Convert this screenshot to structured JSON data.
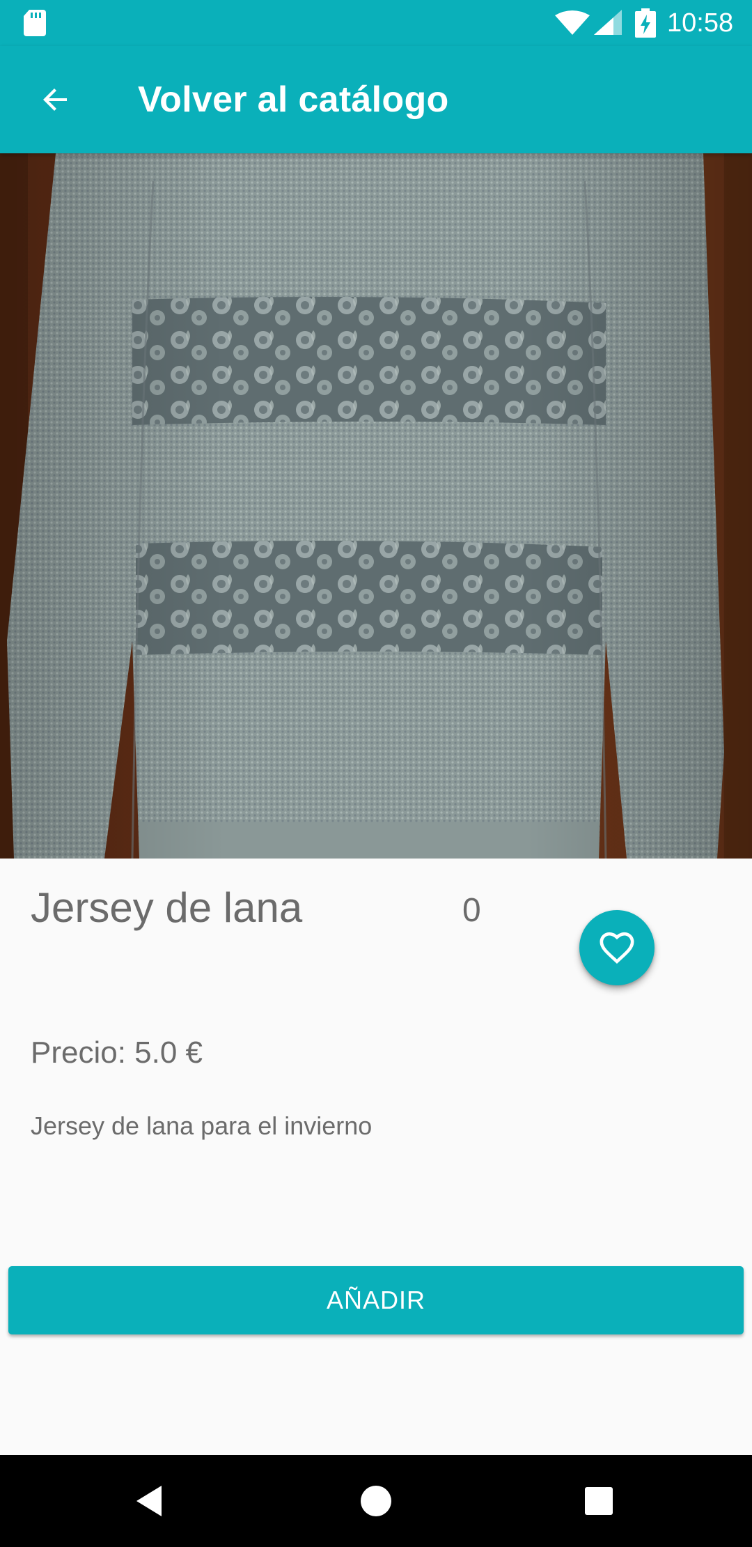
{
  "status_bar": {
    "time": "10:58",
    "icons": [
      "sd-card-icon",
      "wifi-icon",
      "signal-icon",
      "battery-charging-icon"
    ]
  },
  "toolbar": {
    "back_icon": "arrow-back-icon",
    "title": "Volver al catálogo"
  },
  "product": {
    "image_subject": "sweater-photo",
    "name": "Jersey de lana",
    "likes": "0",
    "favorite_icon": "heart-outline-icon",
    "price": "Precio: 5.0 €",
    "description": "Jersey de lana para el invierno"
  },
  "actions": {
    "add_label": "AÑADIR"
  },
  "nav": {
    "icons": [
      "nav-back-icon",
      "nav-home-icon",
      "nav-recents-icon"
    ]
  },
  "colors": {
    "accent": "#0ab0ba",
    "text_secondary": "#6b6b6b",
    "background": "#fafafa"
  }
}
